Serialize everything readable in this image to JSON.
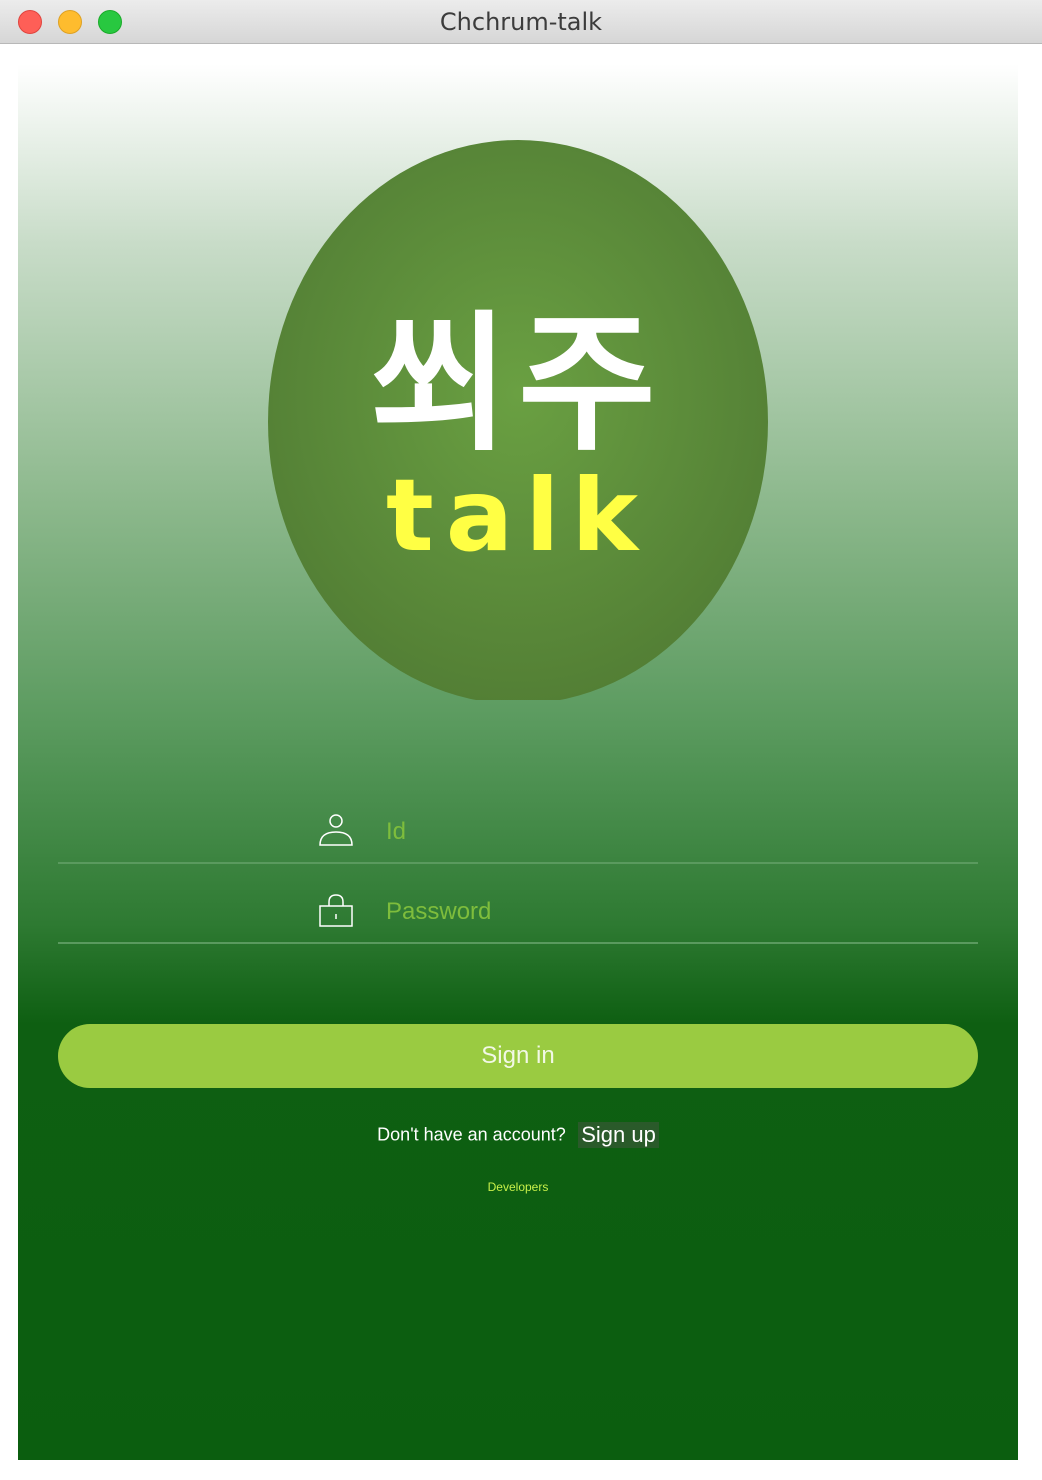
{
  "window": {
    "title": "Chchrum-talk"
  },
  "logo": {
    "korean_text": "쐬주",
    "english_text": "talk",
    "circle_color": "#5a8a3a",
    "korean_color": "#ffffff",
    "english_color": "#ffff44"
  },
  "login": {
    "id_placeholder": "Id",
    "id_value": "",
    "password_placeholder": "Password",
    "password_value": "",
    "user_icon": "user-icon",
    "lock_icon": "lock-icon",
    "sign_in_label": "Sign in",
    "signup_prompt": "Don't have an account?",
    "signup_label": "Sign up",
    "developers_label": "Developers"
  },
  "colors": {
    "accent": "#9acb41",
    "background_dark": "#0b5e0f",
    "placeholder": "#7ebd3c"
  }
}
